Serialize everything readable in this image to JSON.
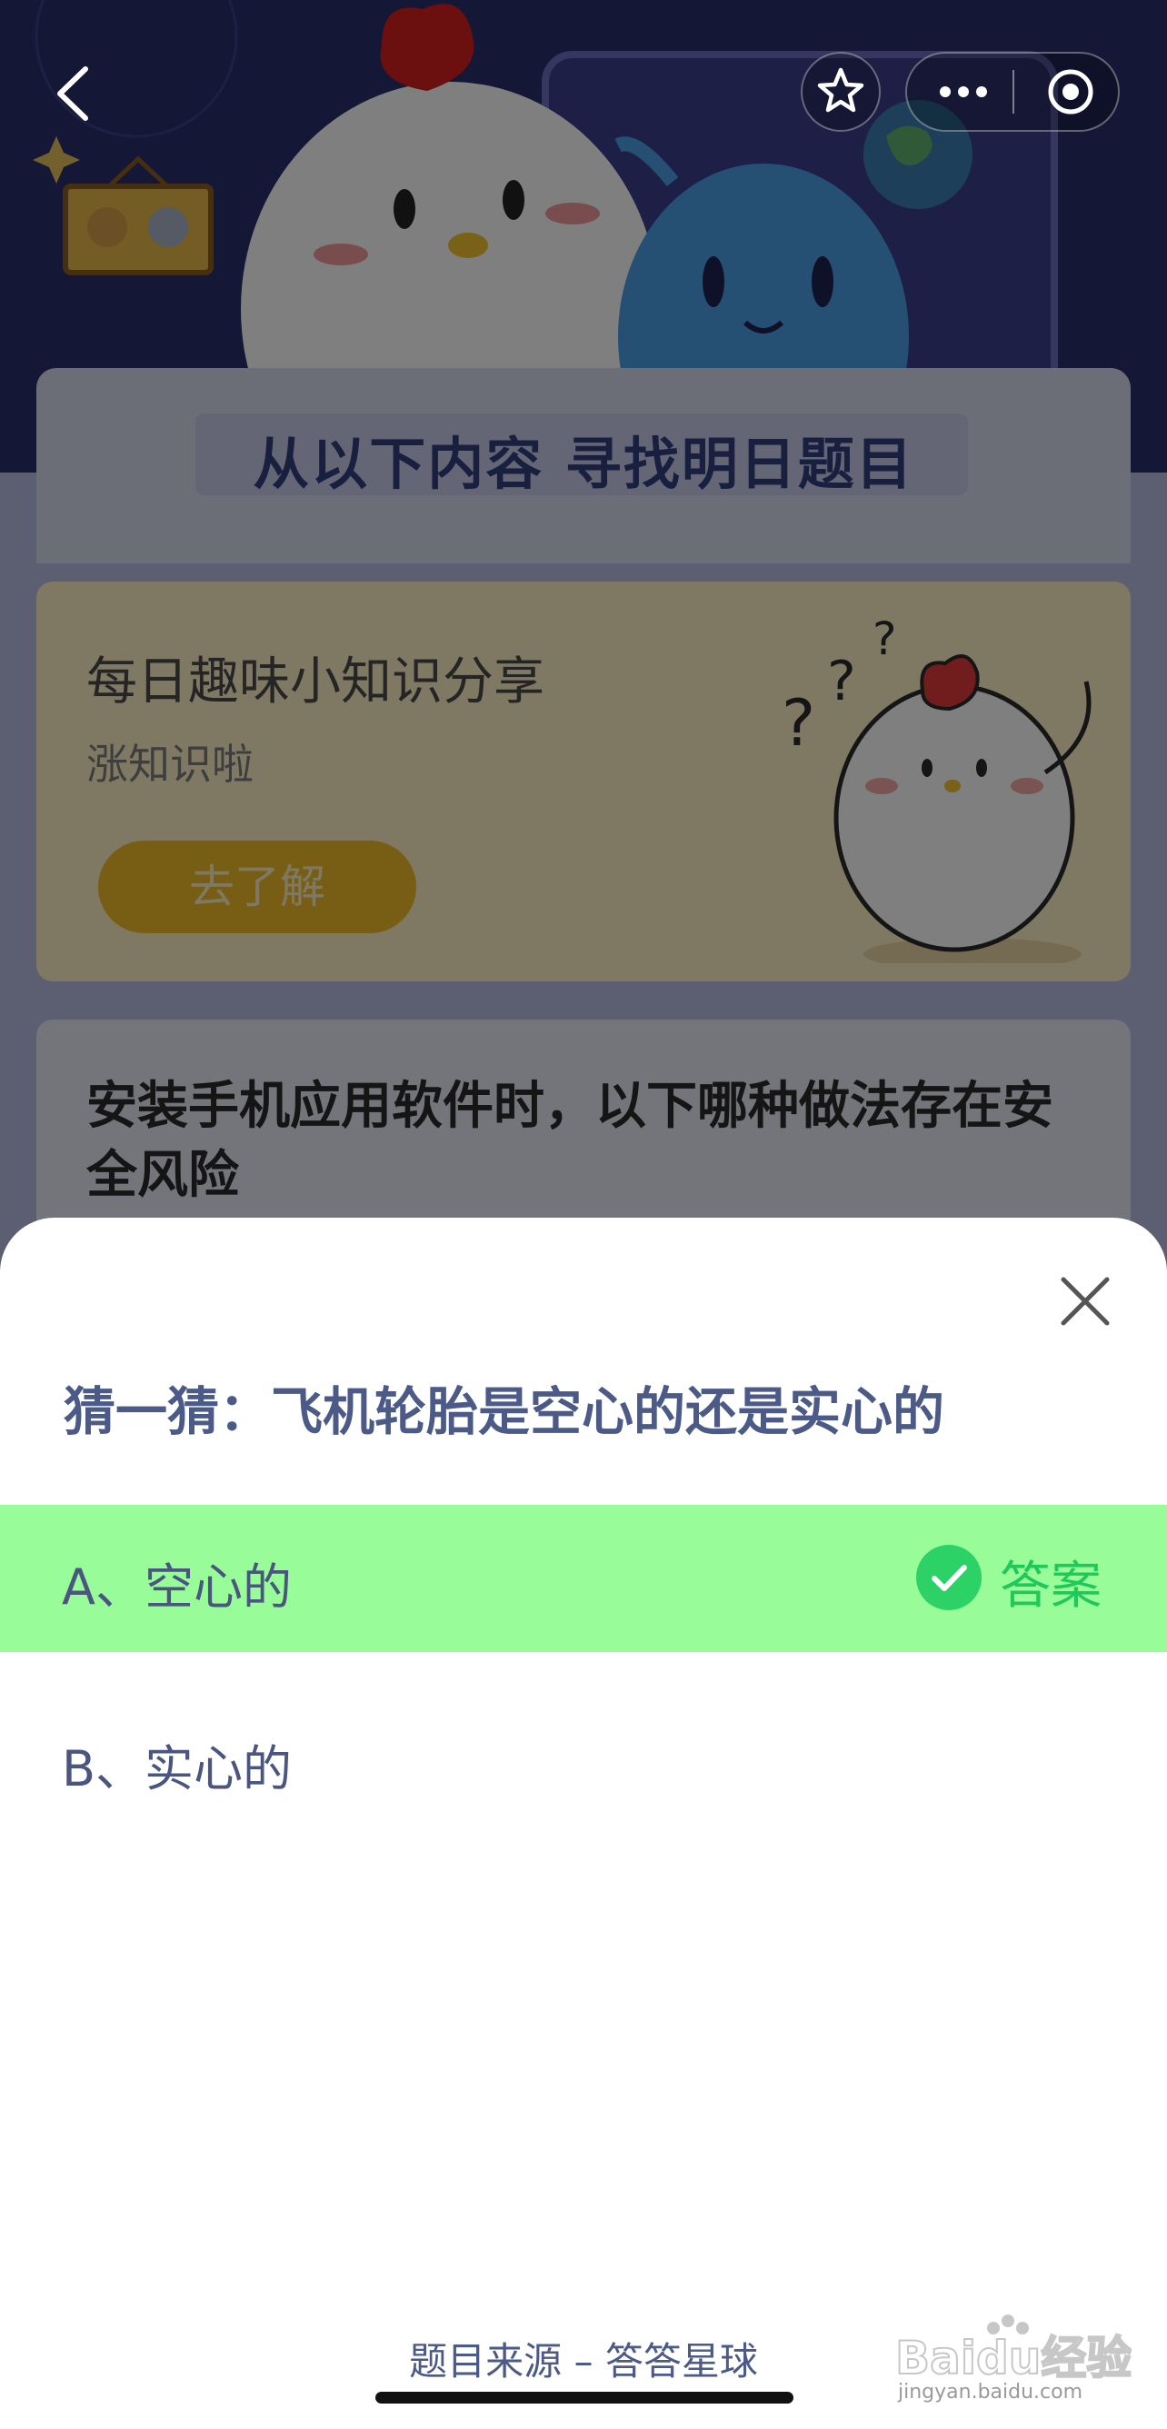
{
  "app": {
    "banner_title": "从以下内容  寻找明日题目"
  },
  "topbar": {
    "back_icon": "chevron-left-icon",
    "favorite_icon": "star-icon",
    "more_icon": "ellipsis-icon",
    "close_icon": "target-circle-icon"
  },
  "knowledge_card": {
    "title": "每日趣味小知识分享",
    "subtitle": "涨知识啦",
    "button_label": "去了解"
  },
  "question_card": {
    "text": "安装手机应用软件时，以下哪种做法存在安全风险"
  },
  "sheet": {
    "title": "猜一猜：飞机轮胎是空心的还是实心的",
    "options": [
      {
        "label": "A、空心的",
        "is_answer": true
      },
      {
        "label": "B、实心的",
        "is_answer": false
      }
    ],
    "answer_tag": "答案",
    "source": "题目来源 – 答答星球",
    "close_icon": "close-x-icon"
  },
  "watermark": {
    "text": "Baidu经验",
    "url": "jingyan.baidu.com"
  },
  "colors": {
    "correct_bg": "#98fc98",
    "correct_accent": "#2cd266",
    "title_text": "#4b5a86",
    "hero_bg": "#2b2f6e"
  }
}
